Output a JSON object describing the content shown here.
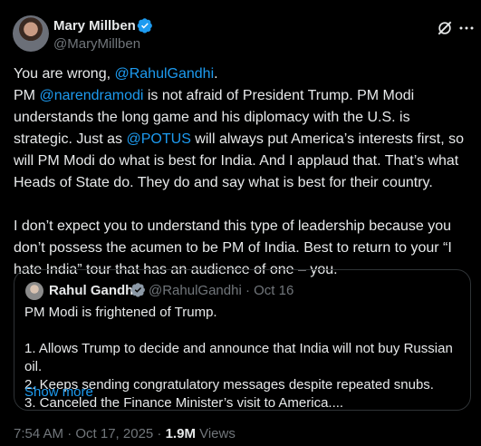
{
  "author": {
    "name": "Mary Millben",
    "handle": "@MaryMillben",
    "verified_color": "#1d9bf0"
  },
  "tweet": {
    "line1_prefix": "You are wrong, ",
    "line1_mention": "@RahulGandhi",
    "line1_suffix": ".",
    "line2_prefix": "PM ",
    "line2_mention": "@narendramodi",
    "line2_text": " is not afraid of President Trump. PM Modi understands the long game and his diplomacy with the U.S. is strategic. Just as ",
    "line2_mention2": "@POTUS",
    "line2_suffix": " will always put America’s interests first, so will PM Modi do what is best for India. And I applaud that. That’s what Heads of State do. They do and say what is best for their country.",
    "para2": "I don’t expect you to understand this type of leadership because you don’t possess the acumen to be PM of India. Best to return to your “I hate India” tour that has an audience of one – you."
  },
  "quote": {
    "name": "Rahul Gandhi",
    "meta": "@RahulGandhi · Oct 16",
    "line1": "PM Modi is frightened of Trump.",
    "item1": "1. Allows Trump to decide and announce that India will not buy Russian oil.",
    "item2": "2. Keeps sending congratulatory messages despite repeated snubs.",
    "item3": "3. Canceled the Finance Minister’s visit to America....",
    "show_more": "Show more"
  },
  "footer": {
    "timestamp": "7:54 AM · Oct 17, 2025 · ",
    "views_count": "1.9M",
    "views_label": " Views"
  },
  "icons": {
    "grok": "grok-icon",
    "more": "more-horizontal-icon"
  }
}
